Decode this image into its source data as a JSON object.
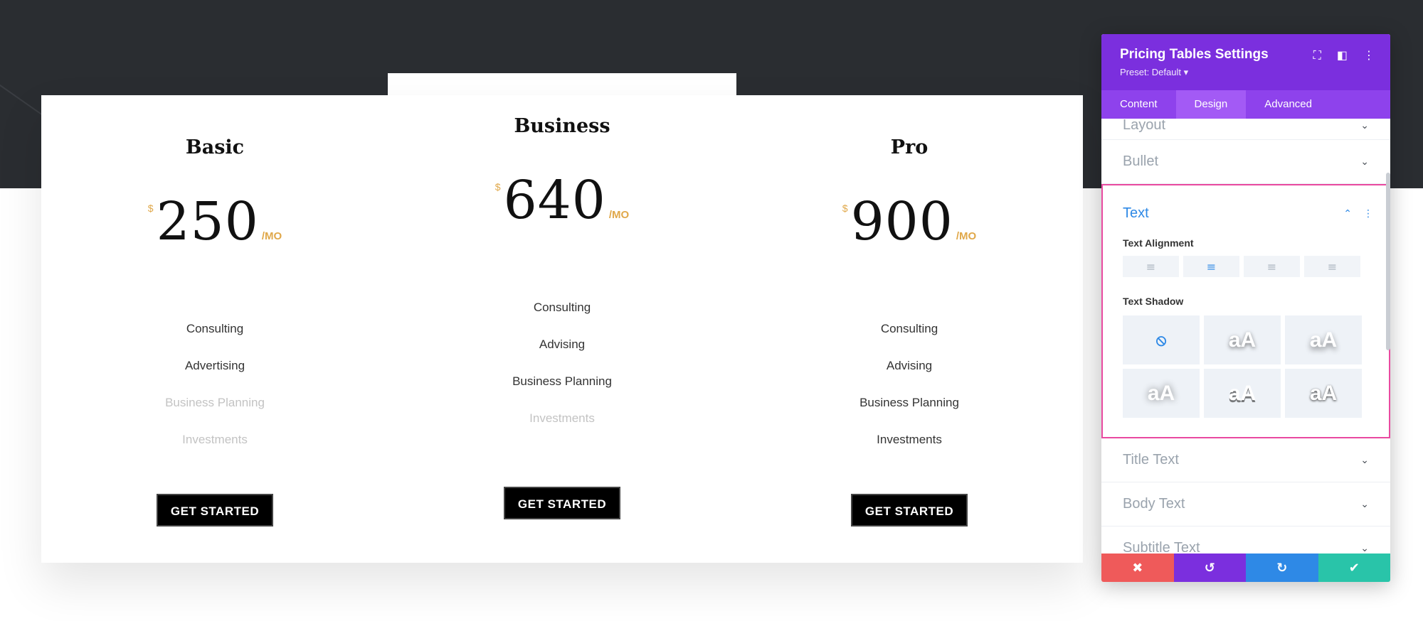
{
  "colors": {
    "accent": "#7b2fde",
    "price_accent": "#e0a84a",
    "highlight_border": "#e94aa0",
    "link_blue": "#2e89e6",
    "cancel": "#ef5a5a",
    "undo": "#7b2fde",
    "redo": "#2e89e6",
    "save": "#29c4a9"
  },
  "plans": [
    {
      "title": "Basic",
      "currency": "$",
      "amount": "250",
      "per": "/MO",
      "features": [
        {
          "label": "Consulting",
          "included": true
        },
        {
          "label": "Advertising",
          "included": true
        },
        {
          "label": "Business Planning",
          "included": false
        },
        {
          "label": "Investments",
          "included": false
        }
      ],
      "cta": "GET STARTED"
    },
    {
      "title": "Business",
      "currency": "$",
      "amount": "640",
      "per": "/MO",
      "features": [
        {
          "label": "Consulting",
          "included": true
        },
        {
          "label": "Advising",
          "included": true
        },
        {
          "label": "Business Planning",
          "included": true
        },
        {
          "label": "Investments",
          "included": false
        }
      ],
      "cta": "GET STARTED"
    },
    {
      "title": "Pro",
      "currency": "$",
      "amount": "900",
      "per": "/MO",
      "features": [
        {
          "label": "Consulting",
          "included": true
        },
        {
          "label": "Advising",
          "included": true
        },
        {
          "label": "Business Planning",
          "included": true
        },
        {
          "label": "Investments",
          "included": true
        }
      ],
      "cta": "GET STARTED"
    }
  ],
  "panel": {
    "title": "Pricing Tables Settings",
    "preset": "Preset: Default ▾",
    "tabs": [
      "Content",
      "Design",
      "Advanced"
    ],
    "active_tab": "Design",
    "sections_above": [
      "Layout",
      "Bullet"
    ],
    "text_section": {
      "label": "Text",
      "alignment_label": "Text Alignment",
      "alignment_options": [
        "left",
        "center",
        "right",
        "justify"
      ],
      "alignment_selected": "center",
      "shadow_label": "Text Shadow",
      "shadow_sample": "aA",
      "shadow_selected": "none"
    },
    "sections_below": [
      "Title Text",
      "Body Text",
      "Subtitle Text"
    ]
  }
}
